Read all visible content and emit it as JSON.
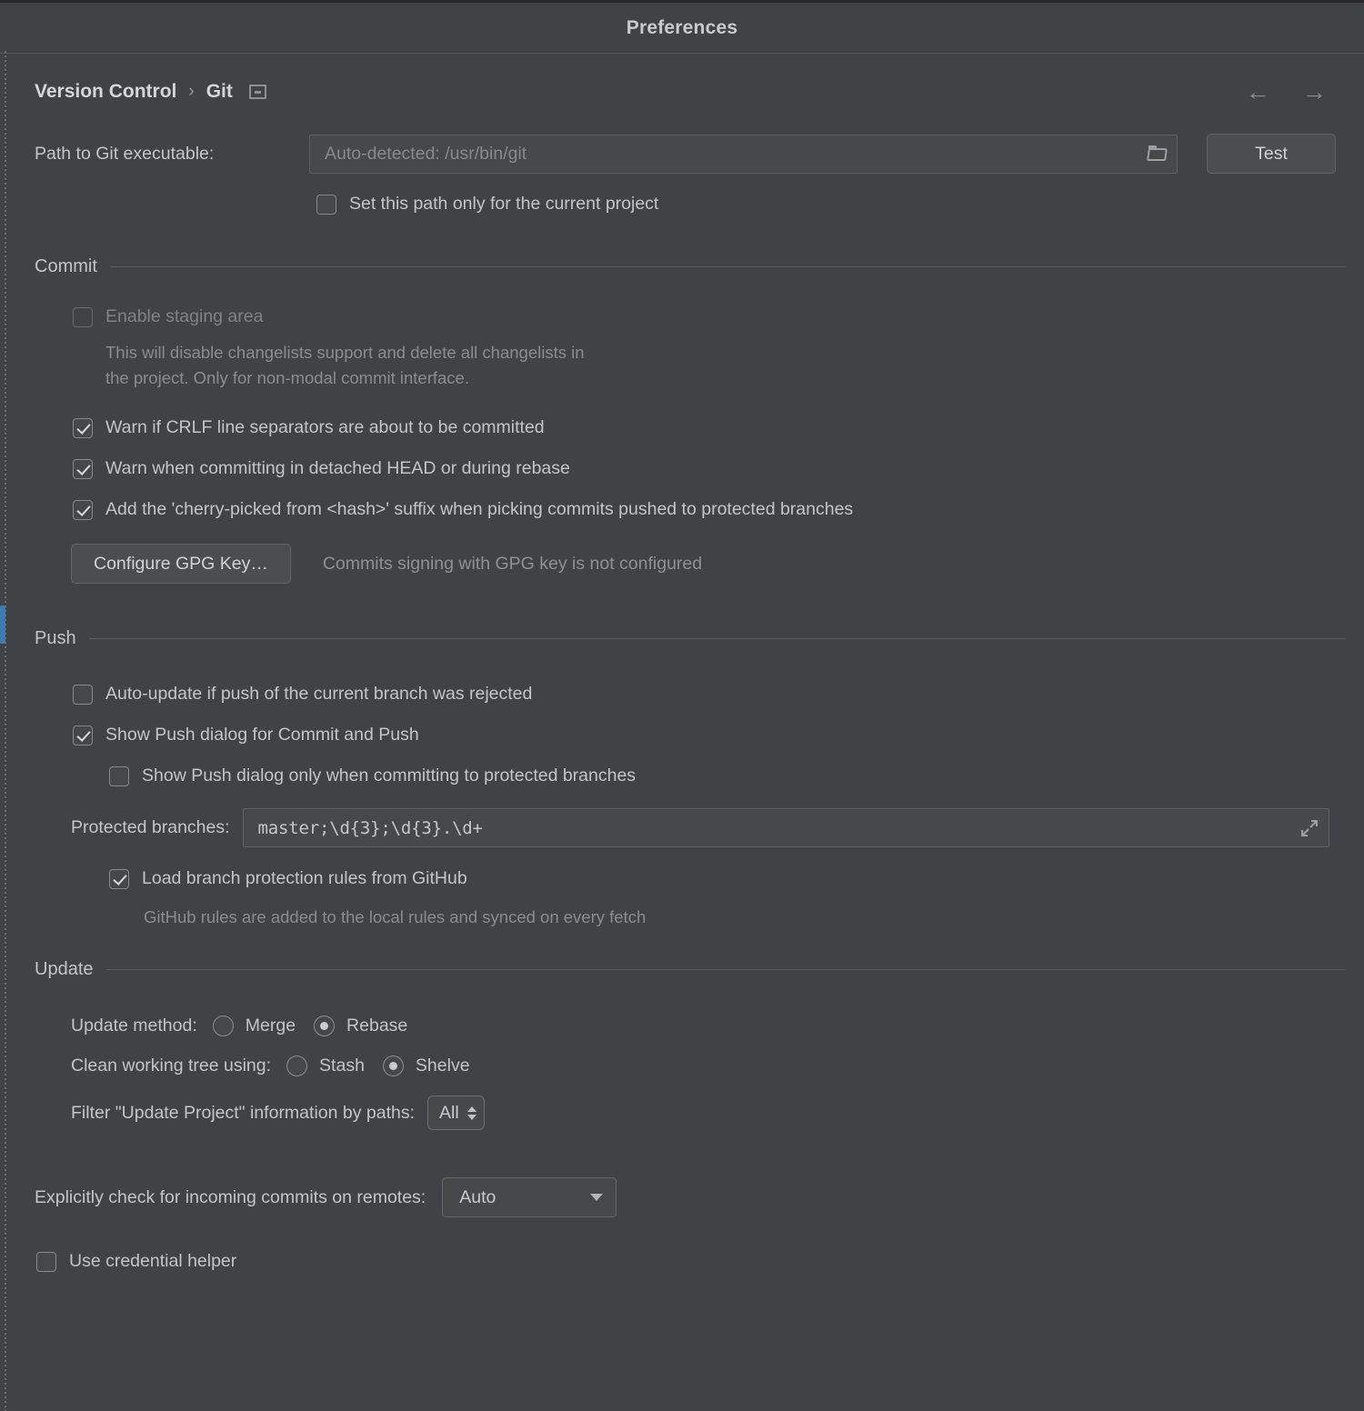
{
  "window": {
    "title": "Preferences"
  },
  "breadcrumb": {
    "root": "Version Control",
    "separator": "›",
    "current": "Git",
    "settings_icon": "settings-window-icon",
    "back_arrow": "←",
    "forward_arrow": "→"
  },
  "git_path": {
    "label": "Path to Git executable:",
    "placeholder": "Auto-detected: /usr/bin/git",
    "value": "",
    "browse_icon": "folder-icon",
    "test_button": "Test",
    "project_only": {
      "label": "Set this path only for the current project",
      "checked": false
    }
  },
  "commit": {
    "section_title": "Commit",
    "enable_staging": {
      "label": "Enable staging area",
      "checked": false,
      "disabled": true
    },
    "staging_help_line1": "This will disable changelists support and delete all changelists in",
    "staging_help_line2": "the project. Only for non-modal commit interface.",
    "warn_crlf": {
      "label": "Warn if CRLF line separators are about to be committed",
      "checked": true
    },
    "warn_detached": {
      "label": "Warn when committing in detached HEAD or during rebase",
      "checked": true
    },
    "cherry_pick_suffix": {
      "label": "Add the 'cherry-picked from <hash>' suffix when picking commits pushed to protected branches",
      "checked": true
    },
    "gpg_button": "Configure GPG Key…",
    "gpg_status": "Commits signing with GPG key is not configured"
  },
  "push": {
    "section_title": "Push",
    "auto_update": {
      "label": "Auto-update if push of the current branch was rejected",
      "checked": false
    },
    "show_push_dialog": {
      "label": "Show Push dialog for Commit and Push",
      "checked": true
    },
    "show_push_protected_only": {
      "label": "Show Push dialog only when committing to protected branches",
      "checked": false
    },
    "protected_branches": {
      "label": "Protected branches:",
      "value": "master;\\d{3};\\d{3}.\\d+",
      "expand_icon": "expand-diagonal-icon"
    },
    "load_github_rules": {
      "label": "Load branch protection rules from GitHub",
      "checked": true
    },
    "github_help": "GitHub rules are added to the local rules and synced on every fetch"
  },
  "update": {
    "section_title": "Update",
    "update_method": {
      "label": "Update method:",
      "options": [
        "Merge",
        "Rebase"
      ],
      "selected": "Rebase"
    },
    "clean_working_tree": {
      "label": "Clean working tree using:",
      "options": [
        "Stash",
        "Shelve"
      ],
      "selected": "Shelve"
    },
    "filter_paths": {
      "label": "Filter \"Update Project\" information by paths:",
      "value": "All"
    }
  },
  "remotes": {
    "incoming_commits": {
      "label": "Explicitly check for incoming commits on remotes:",
      "value": "Auto"
    },
    "credential_helper": {
      "label": "Use credential helper",
      "checked": false
    }
  },
  "colors": {
    "background": "#3f4345",
    "accent": "#3d7bb5",
    "text": "#c3c5c7",
    "muted": "#8d9194",
    "field": "#45494a",
    "border": "#5d6164"
  }
}
